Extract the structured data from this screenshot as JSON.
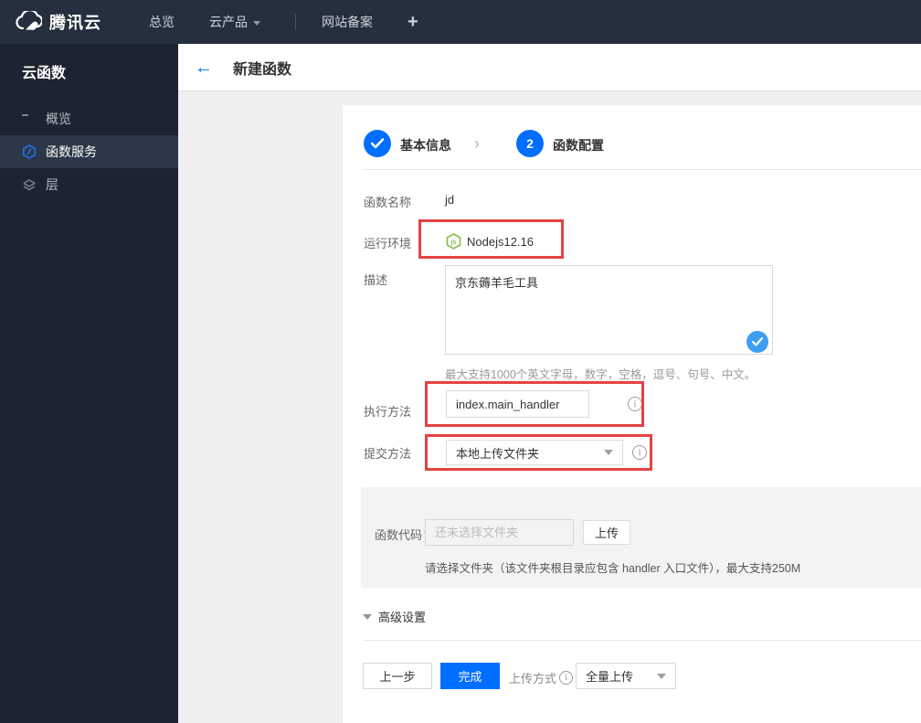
{
  "colors": {
    "accent": "#006eff",
    "annotation_red": "#e64242",
    "node_green": "#84bd45",
    "topbar_bg": "#252f3d",
    "sidebar_bg": "#1c2431"
  },
  "topbar": {
    "brand": "腾讯云",
    "nav": [
      {
        "label": "总览"
      },
      {
        "label": "云产品"
      },
      {
        "label": "网站备案"
      }
    ],
    "plus_label": "+"
  },
  "sidebar": {
    "title": "云函数",
    "items": [
      {
        "label": "概览"
      },
      {
        "label": "函数服务"
      },
      {
        "label": "层"
      }
    ]
  },
  "header": {
    "back_arrow": "←",
    "title": "新建函数"
  },
  "steps": {
    "step1": {
      "label": "基本信息"
    },
    "step2": {
      "number": "2",
      "label": "函数配置"
    }
  },
  "form": {
    "name": {
      "label": "函数名称",
      "value": "jd"
    },
    "runtime": {
      "label": "运行环境",
      "value": "Nodejs12.16",
      "icon_text": "js"
    },
    "description": {
      "label": "描述",
      "value": "京东薅羊毛工具",
      "hint": "最大支持1000个英文字母，数字，空格，逗号、句号、中文。"
    },
    "handler": {
      "label": "执行方法",
      "value": "index.main_handler",
      "info": "i"
    },
    "submit_method": {
      "label": "提交方法",
      "value": "本地上传文件夹",
      "info": "i"
    },
    "code": {
      "label": "函数代码",
      "required_mark": "*",
      "placeholder": "还未选择文件夹",
      "upload_button": "上传",
      "hint": "请选择文件夹（该文件夹根目录应包含 handler 入口文件），最大支持250M"
    }
  },
  "advanced": {
    "label": "高级设置"
  },
  "footer": {
    "prev_button": "上一步",
    "finish_button": "完成",
    "upload_mode_label": "上传方式",
    "upload_mode_info": "i",
    "upload_mode_value": "全量上传"
  },
  "icons": {
    "logo": "cloud-icon",
    "overview": "grid-icon",
    "functions": "hexagon-slash-icon",
    "layers": "layers-icon",
    "runtime": "nodejs-hexagon-icon",
    "step_done": "check-icon",
    "desc_valid": "check-icon",
    "dropdowns": "chevron-down-icon",
    "info": "info-circle-icon"
  }
}
